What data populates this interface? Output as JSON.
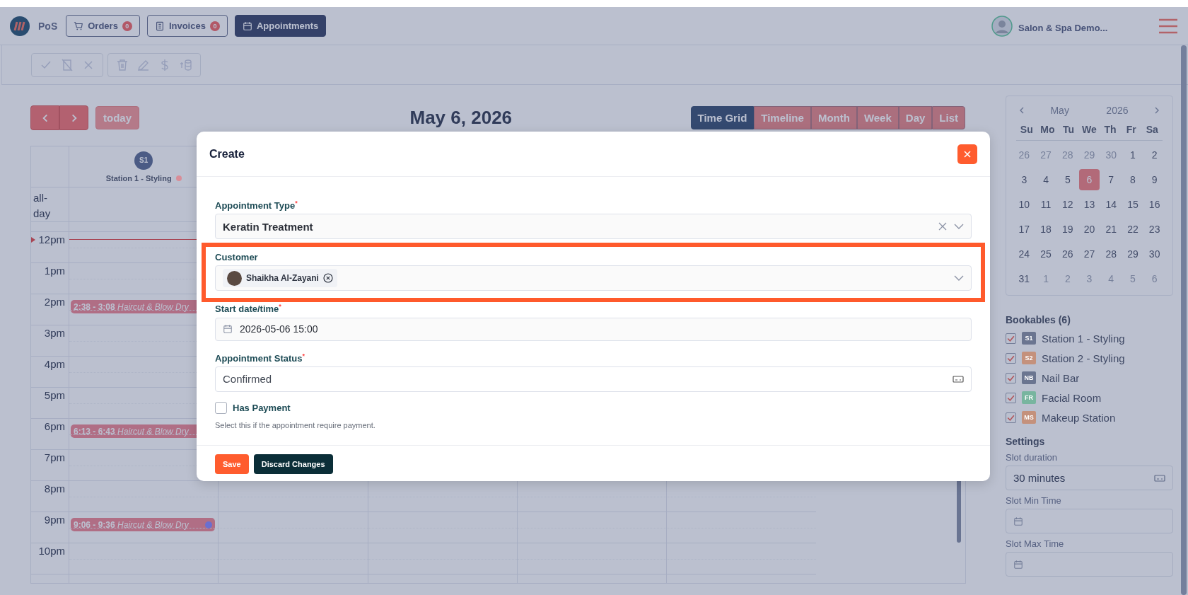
{
  "header": {
    "brand": "PoS",
    "nav": [
      {
        "label": "Orders",
        "count": "0",
        "selected": false
      },
      {
        "label": "Invoices",
        "count": "0",
        "selected": false
      },
      {
        "label": "Appointments",
        "selected": true
      }
    ],
    "user_name": "Salon & Spa Demo..."
  },
  "calendar": {
    "today_button": "today",
    "title": "May 6, 2026",
    "views": [
      {
        "label": "Time Grid",
        "selected": true
      },
      {
        "label": "Timeline",
        "selected": false
      },
      {
        "label": "Month",
        "selected": false
      },
      {
        "label": "Week",
        "selected": false
      },
      {
        "label": "Day",
        "selected": false
      },
      {
        "label": "List",
        "selected": false
      }
    ],
    "columns": [
      {
        "initials": "S1",
        "name": "Station 1 - Styling",
        "color": "#d98d98"
      }
    ],
    "all_day_label": "all-day",
    "hours": [
      {
        "label": "12pm",
        "now": true
      },
      {
        "label": "1pm",
        "now": false
      },
      {
        "label": "2pm",
        "now": false,
        "events": [
          {
            "time": "2:38 - 3:08",
            "title": "Haircut & Blow Dry"
          }
        ]
      },
      {
        "label": "3pm",
        "now": false
      },
      {
        "label": "4pm",
        "now": false
      },
      {
        "label": "5pm",
        "now": false
      },
      {
        "label": "6pm",
        "now": false,
        "events": [
          {
            "time": "6:13 - 6:43",
            "title": "Haircut & Blow Dry"
          }
        ]
      },
      {
        "label": "7pm",
        "now": false
      },
      {
        "label": "8pm",
        "now": false
      },
      {
        "label": "9pm",
        "now": false,
        "events": [
          {
            "time": "9:06 - 9:36",
            "title": "Haircut & Blow Dry",
            "color": "#6a6fd0"
          }
        ]
      },
      {
        "label": "10pm",
        "now": false
      }
    ]
  },
  "sidebar": {
    "mini_calendar": {
      "month": "May",
      "year": "2026",
      "weekdays": [
        "Su",
        "Mo",
        "Tu",
        "We",
        "Th",
        "Fr",
        "Sa"
      ],
      "weeks": [
        [
          {
            "label": "26",
            "muted": true,
            "selected": false
          },
          {
            "label": "27",
            "muted": true,
            "selected": false
          },
          {
            "label": "28",
            "muted": true,
            "selected": false
          },
          {
            "label": "29",
            "muted": true,
            "selected": false
          },
          {
            "label": "30",
            "muted": true,
            "selected": false
          },
          {
            "label": "1",
            "muted": false,
            "selected": false
          },
          {
            "label": "2",
            "muted": false,
            "selected": false
          }
        ],
        [
          {
            "label": "3",
            "muted": false,
            "selected": false
          },
          {
            "label": "4",
            "muted": false,
            "selected": false
          },
          {
            "label": "5",
            "muted": false,
            "selected": false
          },
          {
            "label": "6",
            "muted": false,
            "selected": true
          },
          {
            "label": "7",
            "muted": false,
            "selected": false
          },
          {
            "label": "8",
            "muted": false,
            "selected": false
          },
          {
            "label": "9",
            "muted": false,
            "selected": false
          }
        ],
        [
          {
            "label": "10",
            "muted": false,
            "selected": false
          },
          {
            "label": "11",
            "muted": false,
            "selected": false
          },
          {
            "label": "12",
            "muted": false,
            "selected": false
          },
          {
            "label": "13",
            "muted": false,
            "selected": false
          },
          {
            "label": "14",
            "muted": false,
            "selected": false
          },
          {
            "label": "15",
            "muted": false,
            "selected": false
          },
          {
            "label": "16",
            "muted": false,
            "selected": false
          }
        ],
        [
          {
            "label": "17",
            "muted": false,
            "selected": false
          },
          {
            "label": "18",
            "muted": false,
            "selected": false
          },
          {
            "label": "19",
            "muted": false,
            "selected": false
          },
          {
            "label": "20",
            "muted": false,
            "selected": false
          },
          {
            "label": "21",
            "muted": false,
            "selected": false
          },
          {
            "label": "22",
            "muted": false,
            "selected": false
          },
          {
            "label": "23",
            "muted": false,
            "selected": false
          }
        ],
        [
          {
            "label": "24",
            "muted": false,
            "selected": false
          },
          {
            "label": "25",
            "muted": false,
            "selected": false
          },
          {
            "label": "26",
            "muted": false,
            "selected": false
          },
          {
            "label": "27",
            "muted": false,
            "selected": false
          },
          {
            "label": "28",
            "muted": false,
            "selected": false
          },
          {
            "label": "29",
            "muted": false,
            "selected": false
          },
          {
            "label": "30",
            "muted": false,
            "selected": false
          }
        ],
        [
          {
            "label": "31",
            "muted": false,
            "selected": false
          },
          {
            "label": "1",
            "muted": true,
            "selected": false
          },
          {
            "label": "2",
            "muted": true,
            "selected": false
          },
          {
            "label": "3",
            "muted": true,
            "selected": false
          },
          {
            "label": "4",
            "muted": true,
            "selected": false
          },
          {
            "label": "5",
            "muted": true,
            "selected": false
          },
          {
            "label": "6",
            "muted": true,
            "selected": false
          }
        ]
      ]
    },
    "bookables_title": "Bookables (6)",
    "bookables": [
      {
        "label": "Station 1 - Styling",
        "initials": "S1",
        "color": "#6b7590",
        "checked": true
      },
      {
        "label": "Station 2 - Styling",
        "initials": "S2",
        "color": "#c4917c",
        "checked": true
      },
      {
        "label": "Nail Bar",
        "initials": "NB",
        "color": "#6b7590",
        "checked": true
      },
      {
        "label": "Facial Room",
        "initials": "FR",
        "color": "#78b59f",
        "checked": true
      },
      {
        "label": "Makeup Station",
        "initials": "MS",
        "color": "#c4917c",
        "checked": true
      }
    ],
    "settings_title": "Settings",
    "settings": [
      {
        "label": "Slot duration",
        "kind": "select",
        "value": "30 minutes"
      },
      {
        "label": "Slot Min Time",
        "kind": "time"
      },
      {
        "label": "Slot Max Time",
        "kind": "time"
      }
    ]
  },
  "dialog": {
    "title": "Create",
    "appointment_type": {
      "label": "Appointment Type$^{*}$",
      "value": "Keratin Treatment"
    },
    "customer": {
      "label": "Customer",
      "chip": "Shaikha Al-Zayani"
    },
    "start": {
      "label": "Start date/time$^{*}$",
      "value": "2026-05-06 15:00"
    },
    "status": {
      "label": "Appointment Status$^{*}$",
      "value": "Confirmed"
    },
    "has_payment": {
      "label": "Has Payment",
      "checked": false,
      "hint": "Select this if the appointment require payment."
    },
    "buttons": [
      {
        "label": "Save",
        "kind": "primary"
      },
      {
        "label": "Discard Changes",
        "kind": "secondary"
      }
    ]
  }
}
